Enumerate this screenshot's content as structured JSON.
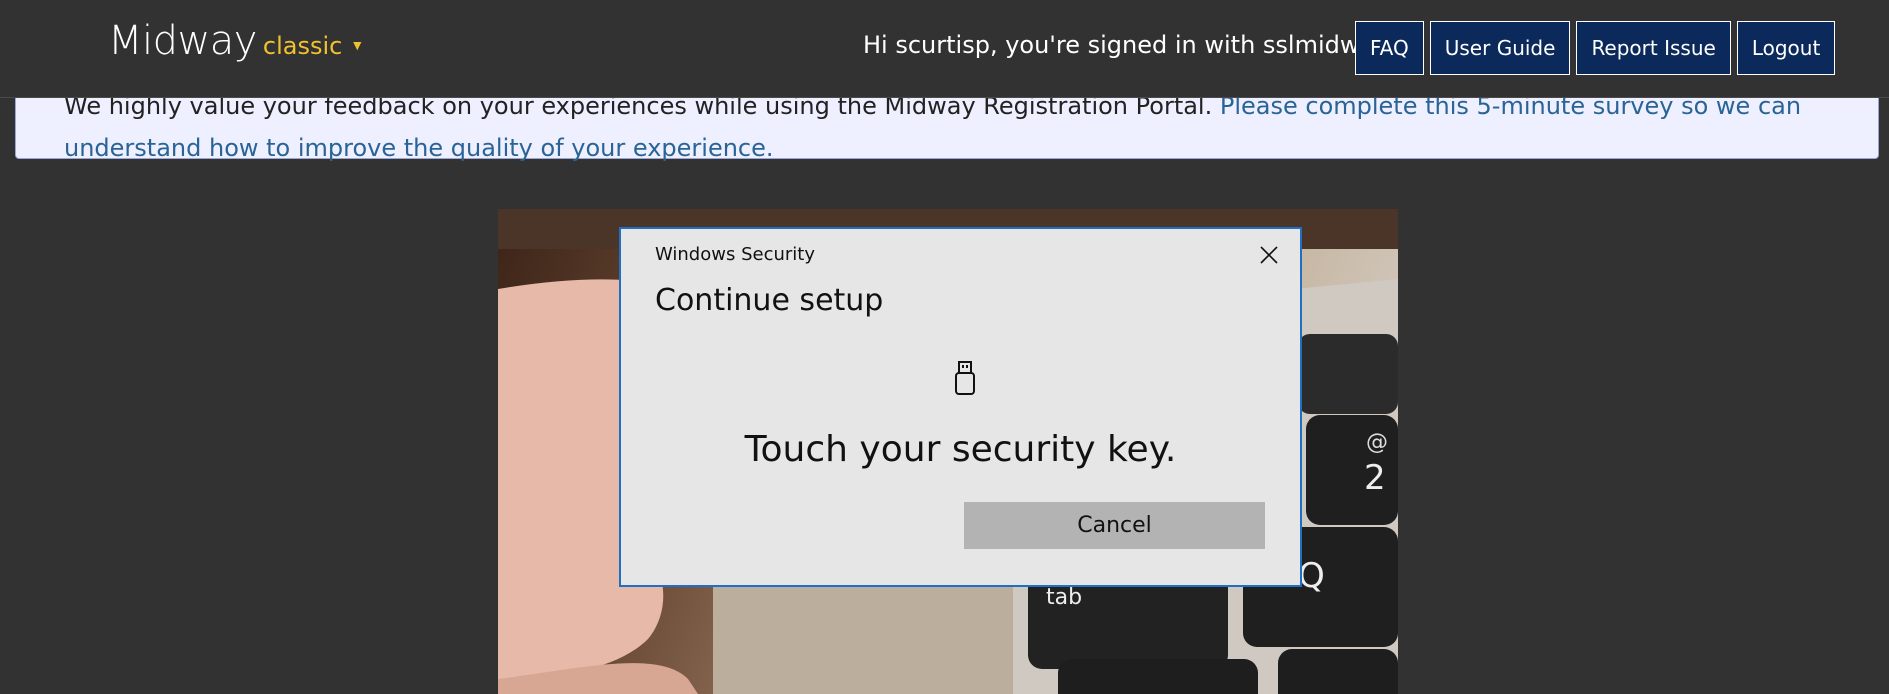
{
  "header": {
    "brand": "Midway",
    "variant": "classic",
    "variant_caret": "▼",
    "greeting": "Hi scurtisp, you're signed in with sslmidway",
    "nav": [
      "FAQ",
      "User Guide",
      "Report Issue",
      "Logout"
    ]
  },
  "banner": {
    "text": "We highly value your feedback on your experiences while using the Midway Registration Portal. ",
    "link": "Please complete this 5-minute survey so we can understand how to improve the quality of your experience."
  },
  "dialog": {
    "titlebar": "Windows Security",
    "heading": "Continue setup",
    "message": "Touch your security key.",
    "cancel": "Cancel",
    "border_color": "#1f6fc4",
    "icon": "usb-key-icon"
  },
  "photo": {
    "keys": {
      "at_symbol": "@",
      "digit": "2",
      "q": "Q",
      "tab": "tab"
    }
  },
  "colors": {
    "header_bg": "#323232",
    "nav_bg": "#0b2a5b",
    "brand_accent": "#f2c12e",
    "banner_bg": "#eeefff",
    "link": "#2a6496"
  }
}
